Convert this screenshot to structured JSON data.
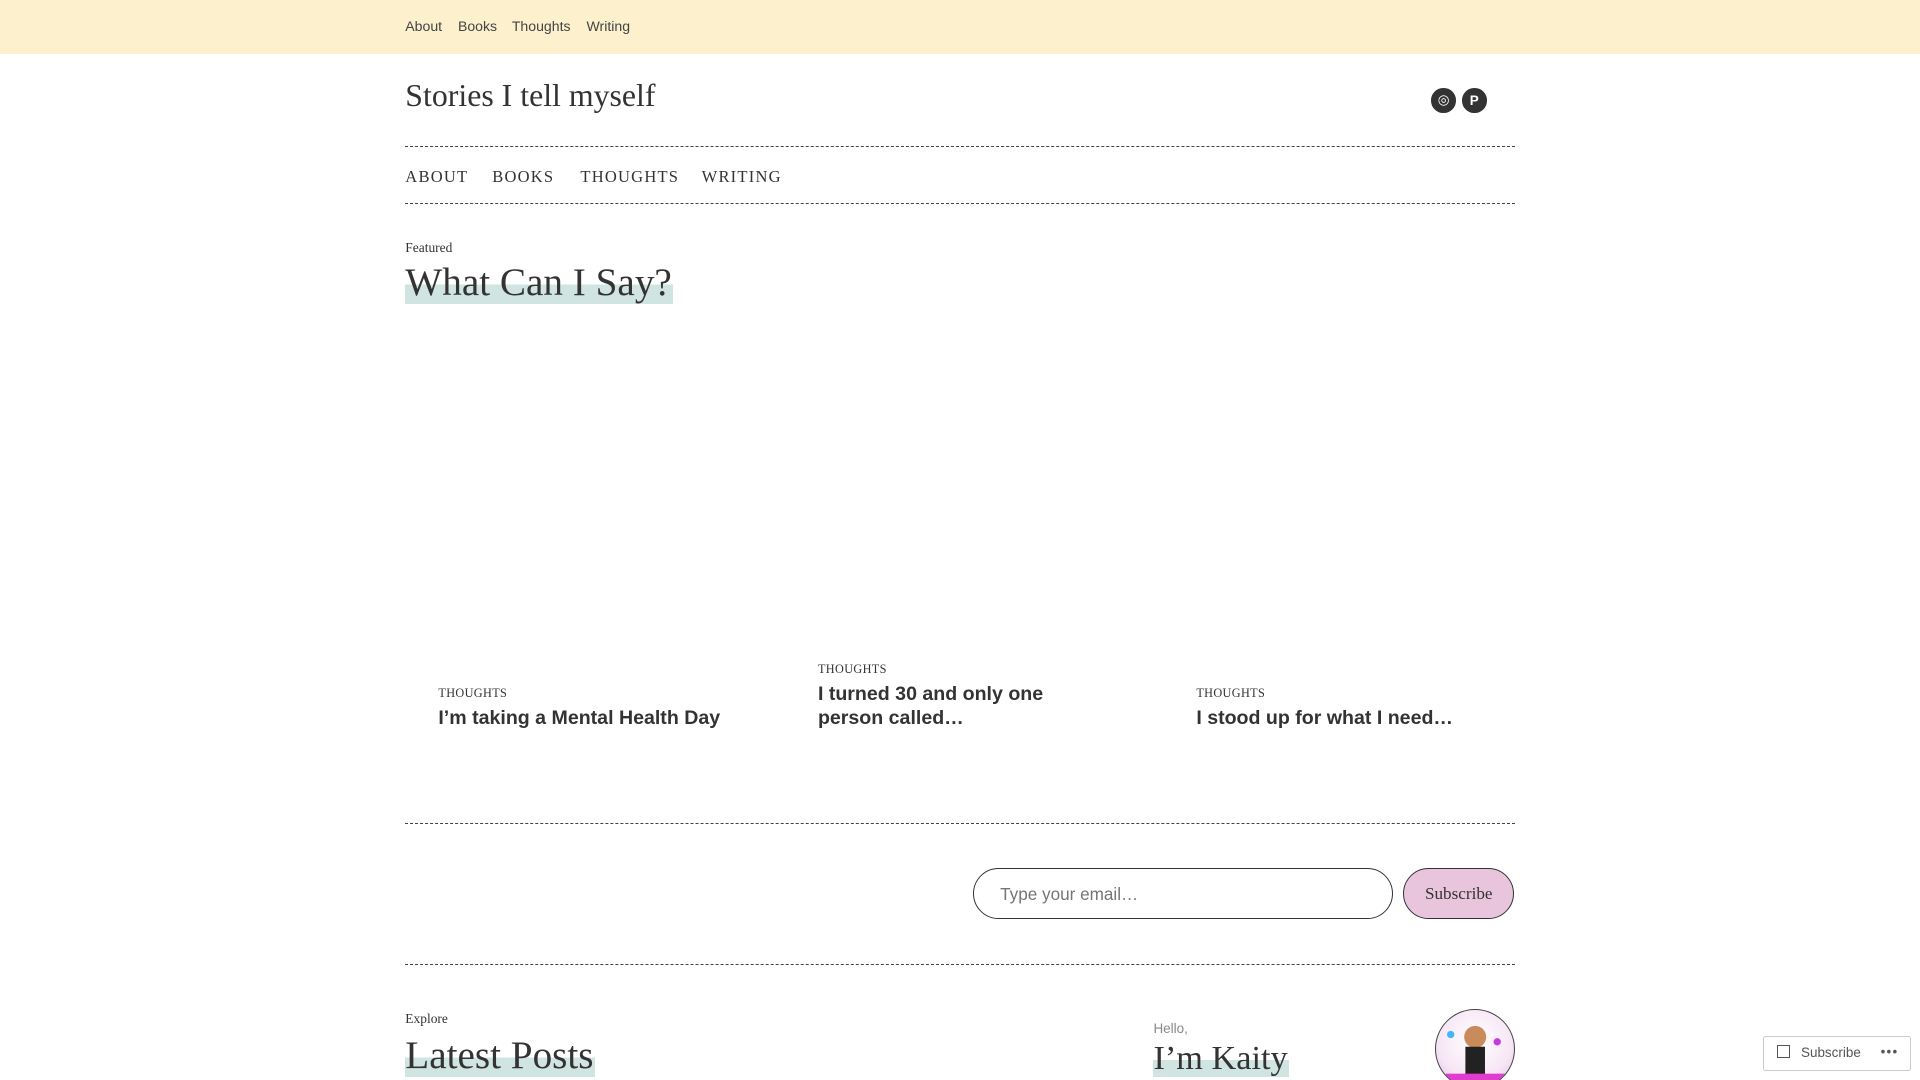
{
  "top_menu": [
    "About",
    "Books",
    "Thoughts",
    "Writing"
  ],
  "site_title": "Stories I tell myself",
  "social": [
    {
      "name": "instagram-icon",
      "glyph": "◎"
    },
    {
      "name": "pinterest-icon",
      "glyph": "P"
    }
  ],
  "main_nav": [
    "ABOUT",
    "BOOKS",
    "THOUGHTS",
    "WRITING"
  ],
  "featured": {
    "kicker": "Featured",
    "title": "What Can I Say?"
  },
  "posts": [
    {
      "category": "THOUGHTS",
      "title": "I’m taking a Mental Health Day"
    },
    {
      "category": "THOUGHTS",
      "title": "I turned 30 and only one person called…"
    },
    {
      "category": "THOUGHTS",
      "title": "I stood up for what I need…"
    }
  ],
  "subscribe": {
    "placeholder": "Type your email…",
    "button": "Subscribe"
  },
  "explore": {
    "kicker": "Explore",
    "title": "Latest Posts"
  },
  "about": {
    "kicker": "Hello,",
    "title": "I’m Kaity"
  },
  "widget": {
    "label": "Subscribe",
    "more": "•••"
  },
  "colors": {
    "topbar": "#fdf0cd",
    "highlight": "#d0e4e1",
    "button": "#e9c4dd"
  }
}
